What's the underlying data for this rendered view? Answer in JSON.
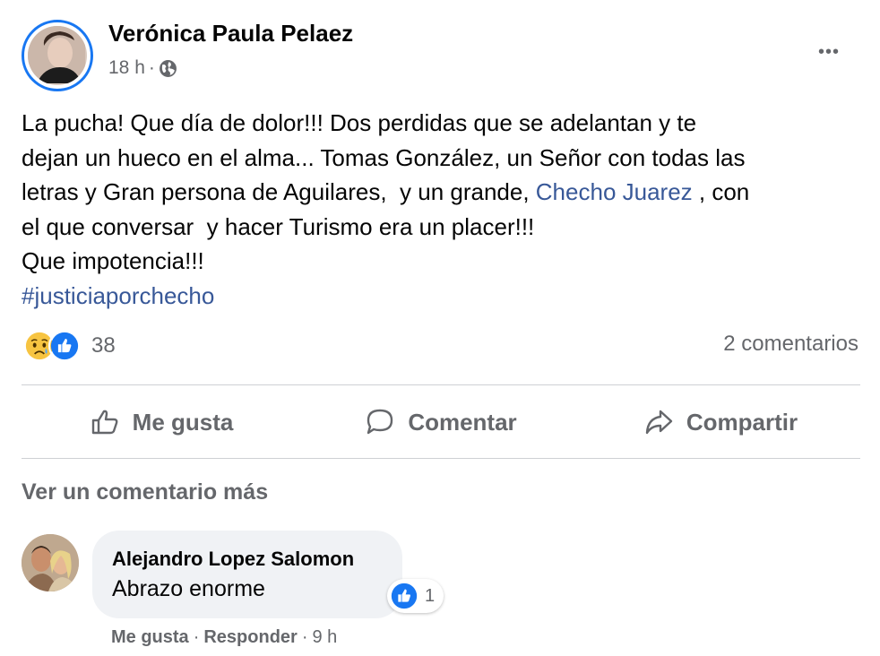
{
  "post": {
    "author": "Verónica Paula Pelaez",
    "time": "18 h",
    "separator": "·",
    "more_label": "•••",
    "text_lines": [
      "La pucha! Que día de dolor!!! Dos perdidas que se adelantan y te",
      "dejan un hueco en el alma... Tomas González, un Señor con todas las",
      "letras y Gran persona de Aguilares,  y un grande, ",
      "el que conversar  y hacer Turismo era un placer!!!",
      "Que impotencia!!!"
    ],
    "mention": "Checho Juarez",
    "after_mention": " , con",
    "hashtag": "#justiciaporchecho",
    "reaction_count": "38",
    "comments_count": "2 comentarios",
    "reactions": [
      "sad-icon",
      "like-icon"
    ]
  },
  "actions": {
    "like": "Me gusta",
    "comment": "Comentar",
    "share": "Compartir"
  },
  "view_more_comments": "Ver un comentario más",
  "comment": {
    "author": "Alejandro Lopez Salomon",
    "text": "Abrazo enorme",
    "like_count": "1",
    "like_action": "Me gusta",
    "reply_action": "Responder",
    "time": "9 h",
    "separator": "·"
  },
  "colors": {
    "link": "#385898",
    "accent": "#1877f2",
    "muted": "#65676b",
    "bubble": "#f0f2f5",
    "divider": "#ced0d4"
  }
}
